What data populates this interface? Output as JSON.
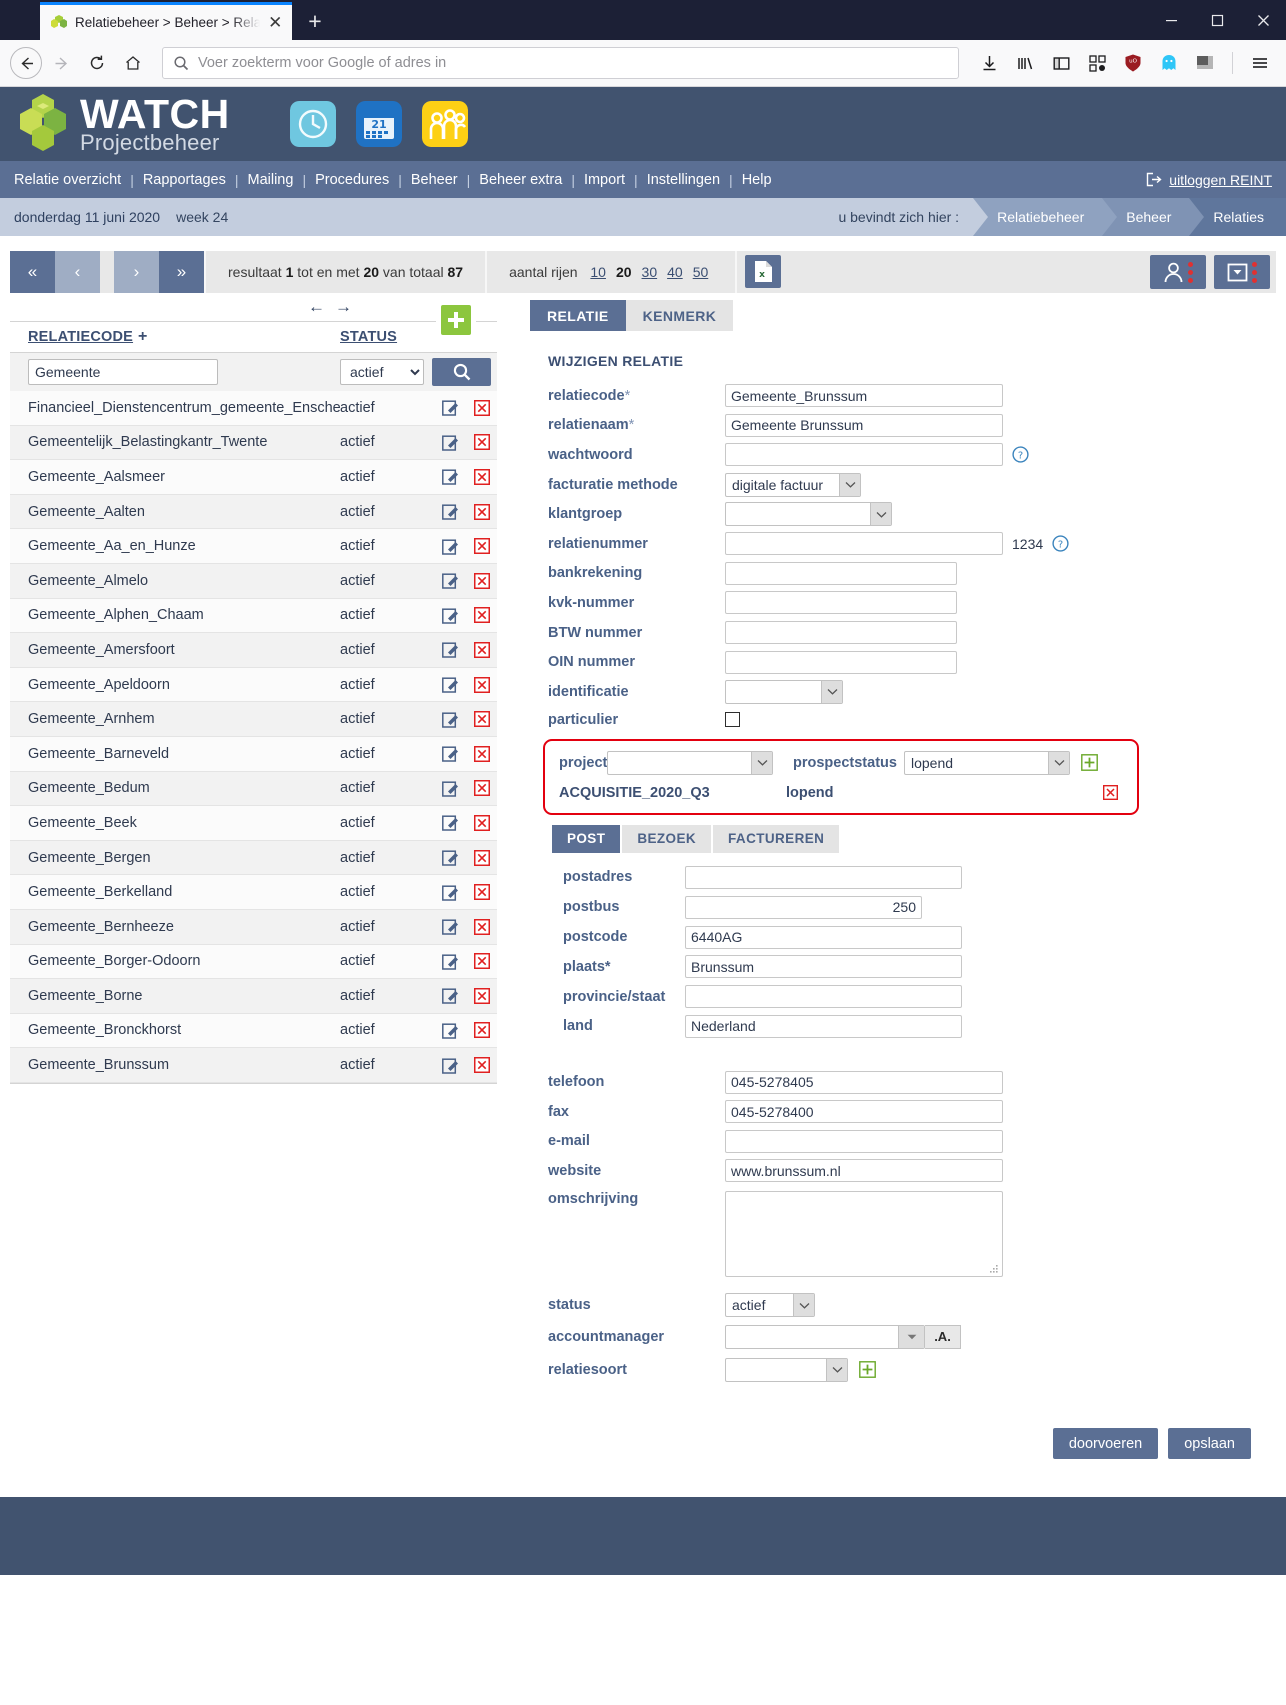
{
  "browser": {
    "tab_title": "Relatiebeheer > Beheer > Relat",
    "tab_close": "✕",
    "new_tab": "+",
    "url_placeholder": "Voer zoekterm voor Google of adres in",
    "minimize": "—",
    "maximize": "□",
    "close": "✕"
  },
  "app": {
    "logo_main": "WATCH",
    "logo_sub": "Projectbeheer",
    "nav": [
      "Relatie overzicht",
      "Rapportages",
      "Mailing",
      "Procedures",
      "Beheer",
      "Beheer extra",
      "Import",
      "Instellingen",
      "Help"
    ],
    "nav_separator": "|",
    "logout": "uitloggen REINT",
    "date": "donderdag 11 juni 2020",
    "week": "week 24",
    "here_label": "u bevindt zich hier :",
    "breadcrumb": [
      "Relatiebeheer",
      "Beheer",
      "Relaties"
    ]
  },
  "toolbar": {
    "first": "«",
    "prev": "‹",
    "next": "›",
    "last": "»",
    "result_prefix": "resultaat",
    "result_from": "1",
    "result_mid": "tot en met",
    "result_to": "20",
    "result_of": "van totaal",
    "result_total": "87",
    "rows_label": "aantal rijen",
    "row_options": [
      "10",
      "20",
      "30",
      "40",
      "50"
    ],
    "rows_selected": "20"
  },
  "list": {
    "arrow_left": "←",
    "arrow_right": "→",
    "columns": [
      "RELATIECODE",
      "STATUS"
    ],
    "column_plus": "+",
    "filter_value": "Gemeente",
    "filter_status": "actief",
    "rows": [
      {
        "code": "Financieel_Dienstencentrum_gemeente_Enschede",
        "status": "actief"
      },
      {
        "code": "Gemeentelijk_Belastingkantr_Twente",
        "status": "actief"
      },
      {
        "code": "Gemeente_Aalsmeer",
        "status": "actief"
      },
      {
        "code": "Gemeente_Aalten",
        "status": "actief"
      },
      {
        "code": "Gemeente_Aa_en_Hunze",
        "status": "actief"
      },
      {
        "code": "Gemeente_Almelo",
        "status": "actief"
      },
      {
        "code": "Gemeente_Alphen_Chaam",
        "status": "actief"
      },
      {
        "code": "Gemeente_Amersfoort",
        "status": "actief"
      },
      {
        "code": "Gemeente_Apeldoorn",
        "status": "actief"
      },
      {
        "code": "Gemeente_Arnhem",
        "status": "actief"
      },
      {
        "code": "Gemeente_Barneveld",
        "status": "actief"
      },
      {
        "code": "Gemeente_Bedum",
        "status": "actief"
      },
      {
        "code": "Gemeente_Beek",
        "status": "actief"
      },
      {
        "code": "Gemeente_Bergen",
        "status": "actief"
      },
      {
        "code": "Gemeente_Berkelland",
        "status": "actief"
      },
      {
        "code": "Gemeente_Bernheeze",
        "status": "actief"
      },
      {
        "code": "Gemeente_Borger-Odoorn",
        "status": "actief"
      },
      {
        "code": "Gemeente_Borne",
        "status": "actief"
      },
      {
        "code": "Gemeente_Bronckhorst",
        "status": "actief"
      },
      {
        "code": "Gemeente_Brunssum",
        "status": "actief"
      }
    ]
  },
  "form": {
    "tabs": [
      {
        "label": "RELATIE",
        "active": true
      },
      {
        "label": "KENMERK",
        "active": false
      }
    ],
    "section_title": "WIJZIGEN RELATIE",
    "fields": {
      "relatiecode_label": "relatiecode",
      "relatiecode_value": "Gemeente_Brunssum",
      "relatienaam_label": "relatienaam",
      "relatienaam_value": "Gemeente Brunssum",
      "wachtwoord_label": "wachtwoord",
      "wachtwoord_value": "",
      "facturatie_label": "facturatie methode",
      "facturatie_value": "digitale factuur",
      "klantgroep_label": "klantgroep",
      "klantgroep_value": "",
      "relatienummer_label": "relatienummer",
      "relatienummer_value": "",
      "relatienummer_hint": "1234",
      "bankrekening_label": "bankrekening",
      "bankrekening_value": "",
      "kvk_label": "kvk-nummer",
      "kvk_value": "",
      "btw_label": "BTW nummer",
      "btw_value": "",
      "oin_label": "OIN nummer",
      "oin_value": "",
      "identificatie_label": "identificatie",
      "identificatie_value": "",
      "particulier_label": "particulier",
      "required_star": "*"
    },
    "project_block": {
      "project_label": "project",
      "project_value": "",
      "prospectstatus_label": "prospectstatus",
      "prospectstatus_value": "lopend",
      "row_project": "ACQUISITIE_2020_Q3",
      "row_status": "lopend"
    },
    "address_tabs": [
      {
        "label": "POST",
        "active": true
      },
      {
        "label": "BEZOEK",
        "active": false
      },
      {
        "label": "FACTUREREN",
        "active": false
      }
    ],
    "address": {
      "postadres_label": "postadres",
      "postadres_value": "",
      "postbus_label": "postbus",
      "postbus_value": "250",
      "postcode_label": "postcode",
      "postcode_value": "6440AG",
      "plaats_label": "plaats",
      "plaats_value": "Brunssum",
      "provincie_label": "provincie/staat",
      "provincie_value": "",
      "land_label": "land",
      "land_value": "Nederland"
    },
    "contact": {
      "telefoon_label": "telefoon",
      "telefoon_value": "045-5278405",
      "fax_label": "fax",
      "fax_value": "045-5278400",
      "email_label": "e-mail",
      "email_value": "",
      "website_label": "website",
      "website_value": "www.brunssum.nl",
      "omschrijving_label": "omschrijving",
      "omschrijving_value": "",
      "status_label": "status",
      "status_value": "actief",
      "accountmanager_label": "accountmanager",
      "accountmanager_value": "",
      "accountmanager_btn": ".A.",
      "relatiesoort_label": "relatiesoort",
      "relatiesoort_value": ""
    },
    "buttons": {
      "doorvoeren": "doorvoeren",
      "opslaan": "opslaan"
    }
  },
  "colors": {
    "brand_dark": "#41536f",
    "brand_nav": "#5b6f94",
    "crumb": "#c3cdde",
    "accent_green": "#8cc63e",
    "accent_red": "#e3000f"
  }
}
